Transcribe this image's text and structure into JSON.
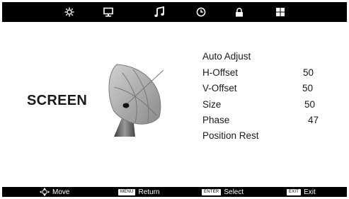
{
  "top_menu": {
    "tabs": [
      {
        "icon": "gear-icon"
      },
      {
        "icon": "monitor-icon"
      },
      {
        "icon": "music-note-icon"
      },
      {
        "icon": "clock-icon"
      },
      {
        "icon": "lock-icon"
      },
      {
        "icon": "windows-grid-icon"
      }
    ]
  },
  "page": {
    "title": "SCREEN"
  },
  "menu": {
    "items": [
      {
        "label": "Auto Adjust",
        "value": ""
      },
      {
        "label": "H-Offset",
        "value": "50"
      },
      {
        "label": "V-Offset",
        "value": "50"
      },
      {
        "label": "Size",
        "value": "50"
      },
      {
        "label": "Phase",
        "value": "47"
      },
      {
        "label": "Position Rest",
        "value": ""
      }
    ]
  },
  "help_bar": {
    "move": {
      "icon": "arrows-move-icon",
      "text": "Move"
    },
    "return": {
      "key": "MENU",
      "text": "Return"
    },
    "select": {
      "key": "ENTER",
      "text": "Select"
    },
    "exit": {
      "key": "EXIT",
      "text": "Exit"
    }
  },
  "colors": {
    "bar": "#000000",
    "background": "#ffffff",
    "text": "#1a1a1a"
  }
}
